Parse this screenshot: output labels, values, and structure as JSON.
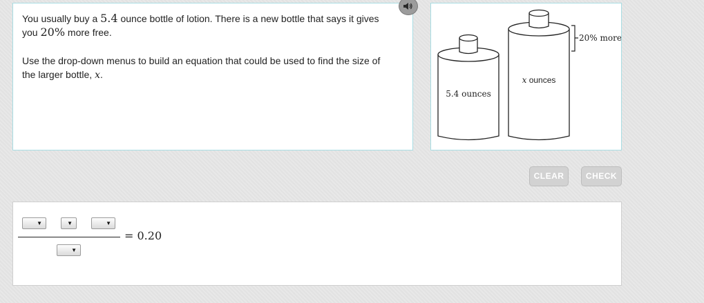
{
  "question": {
    "line1_prefix": "You usually buy a ",
    "line1_size": "5.4",
    "line1_suffix": " ounce bottle of lotion. There is a new bottle that says it gives",
    "line2_prefix": "you ",
    "line2_percent": "20%",
    "line2_suffix": " more free.",
    "instruction_prefix": "Use the drop-down menus to build an equation that could be used to find the size of",
    "instruction_line2": "the larger bottle, ",
    "instruction_var": "x",
    "instruction_end": "."
  },
  "figure": {
    "small_bottle_label": "5.4 ounces",
    "large_bottle_var": "x",
    "large_bottle_unit": " ounces",
    "bracket_label": "20% more"
  },
  "controls": {
    "clear_label": "CLEAR",
    "check_label": "CHECK"
  },
  "equation": {
    "rhs": "= 0.20",
    "dropdown_arrow": "▼"
  },
  "icons": {
    "audio": "speaker-icon"
  }
}
